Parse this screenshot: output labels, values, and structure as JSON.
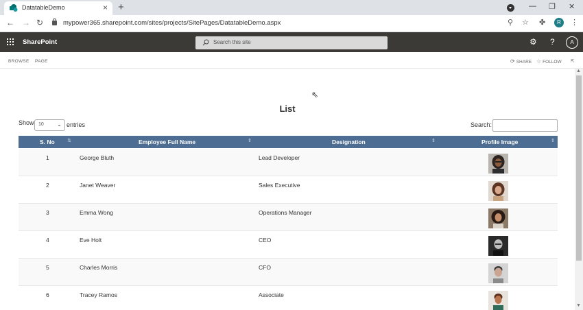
{
  "browser": {
    "tab_title": "DatatableDemo",
    "url": "mypower365.sharepoint.com/sites/projects/SitePages/DatatableDemo.aspx",
    "profile_initial": "R"
  },
  "suite": {
    "app_name": "SharePoint",
    "search_placeholder": "Search this site",
    "user_initial": "A"
  },
  "ribbon": {
    "tabs": [
      "BROWSE",
      "PAGE"
    ],
    "share_label": "SHARE",
    "follow_label": "FOLLOW"
  },
  "page": {
    "title": "List",
    "show_label": "Show",
    "entries_value": "10",
    "entries_label": "entries",
    "search_label": "Search:",
    "search_value": ""
  },
  "table": {
    "columns": [
      "S. No",
      "Employee Full Name",
      "Designation",
      "Profile Image"
    ],
    "rows": [
      {
        "sno": "1",
        "name": "George Bluth",
        "designation": "Lead Developer",
        "image": "george-bluth-photo"
      },
      {
        "sno": "2",
        "name": "Janet Weaver",
        "designation": "Sales Executive",
        "image": "janet-weaver-photo"
      },
      {
        "sno": "3",
        "name": "Emma Wong",
        "designation": "Operations Manager",
        "image": "emma-wong-photo"
      },
      {
        "sno": "4",
        "name": "Eve Holt",
        "designation": "CEO",
        "image": "eve-holt-photo"
      },
      {
        "sno": "5",
        "name": "Charles Morris",
        "designation": "CFO",
        "image": "charles-morris-photo"
      },
      {
        "sno": "6",
        "name": "Tracey Ramos",
        "designation": "Associate",
        "image": "tracey-ramos-photo"
      }
    ]
  },
  "colors": {
    "suite_bar": "#3c3a36",
    "table_header": "#4d6d92"
  }
}
